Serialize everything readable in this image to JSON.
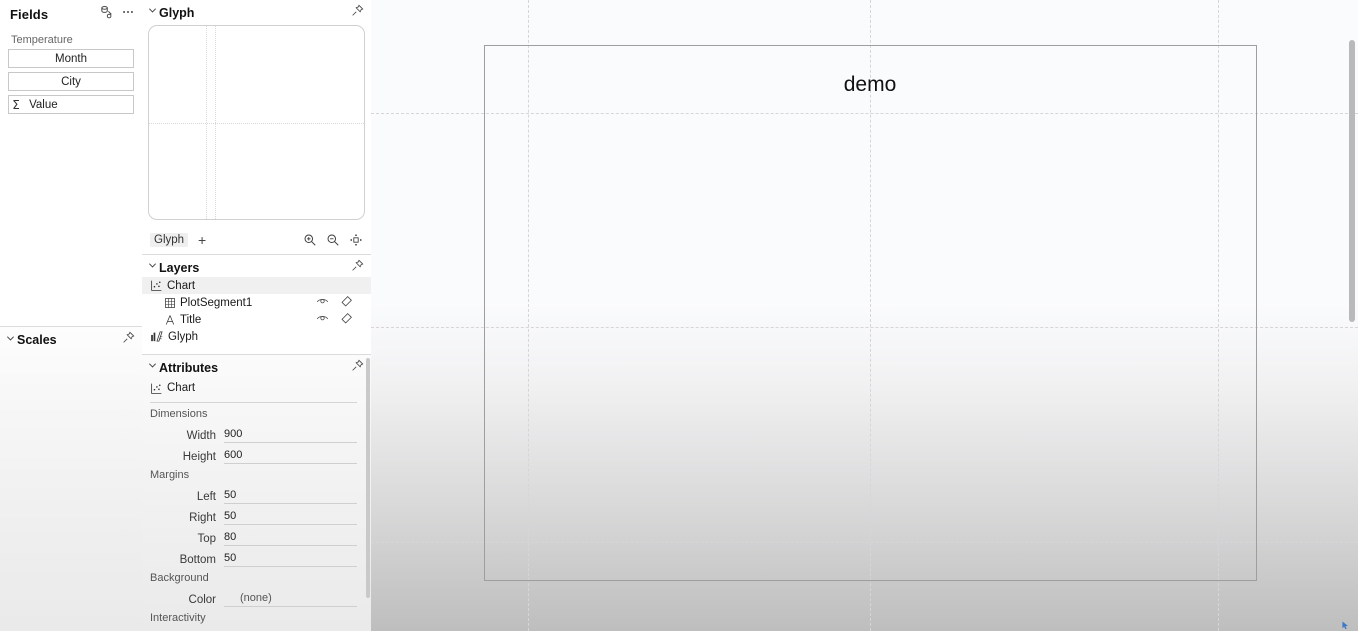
{
  "fields_panel": {
    "title": "Fields",
    "icons": [
      {
        "name": "bind-data-icon",
        "label": "bind-data-icon"
      },
      {
        "name": "more-options-icon",
        "label": "more-options-icon"
      }
    ],
    "group_label": "Temperature",
    "items": [
      {
        "label": "Month",
        "aggregate": ""
      },
      {
        "label": "City",
        "aggregate": ""
      },
      {
        "label": "Value",
        "aggregate": "Σ"
      }
    ]
  },
  "scales_panel": {
    "title": "Scales",
    "pin_icon": "pin-icon",
    "chevron": "ⱽ"
  },
  "glyph_panel": {
    "title": "Glyph",
    "pin_icon": "pin-icon",
    "tab_label": "Glyph",
    "add_label": "+",
    "zoom_in_icon": "zoom-in-icon",
    "zoom_out_icon": "zoom-out-icon",
    "fit_icon": "fit-to-view-icon"
  },
  "layers_panel": {
    "title": "Layers",
    "pin_icon": "pin-icon",
    "rows": [
      {
        "label": "Chart",
        "icon": "chart-icon",
        "selected": true,
        "indent": false,
        "actions": false
      },
      {
        "label": "PlotSegment1",
        "icon": "plot-segment-icon",
        "selected": false,
        "indent": true,
        "actions": true
      },
      {
        "label": "Title",
        "icon": "text-icon",
        "selected": false,
        "indent": true,
        "actions": true
      },
      {
        "label": "Glyph",
        "icon": "glyph-icon",
        "selected": false,
        "indent": false,
        "actions": false
      }
    ],
    "visibility_icon": "eye-icon",
    "delete_icon": "eraser-icon"
  },
  "attributes_panel": {
    "title": "Attributes",
    "pin_icon": "pin-icon",
    "object_label": "Chart",
    "object_icon": "chart-icon",
    "sections": {
      "dimensions_label": "Dimensions",
      "width_label": "Width",
      "width_value": "900",
      "height_label": "Height",
      "height_value": "600",
      "margins_label": "Margins",
      "left_label": "Left",
      "left_value": "50",
      "right_label": "Right",
      "right_value": "50",
      "top_label": "Top",
      "top_value": "80",
      "bottom_label": "Bottom",
      "bottom_value": "50",
      "background_label": "Background",
      "color_label": "Color",
      "color_value": "(none)",
      "interactivity_label": "Interactivity"
    }
  },
  "canvas": {
    "chart_title": "demo",
    "scrollbar": "vertical-scrollbar"
  }
}
